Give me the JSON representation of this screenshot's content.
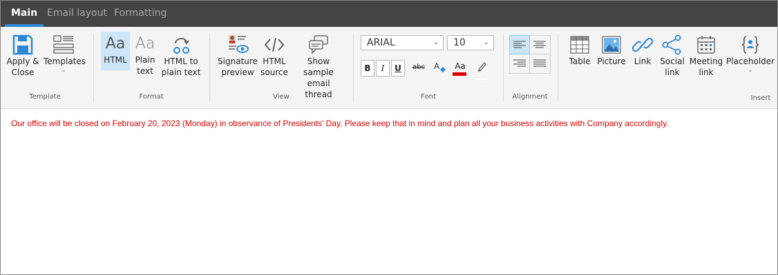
{
  "tabs": [
    {
      "label": "Main",
      "active": true
    },
    {
      "label": "Email layout",
      "active": false
    },
    {
      "label": "Formatting",
      "active": false
    }
  ],
  "groups": {
    "template": {
      "label": "Template",
      "apply_close": {
        "line1": "Apply &",
        "line2": "Close",
        "icon": "floppy-disk-icon"
      },
      "templates": {
        "line1": "Templates",
        "icon": "templates-list-icon"
      }
    },
    "format": {
      "label": "Format",
      "html": {
        "icon_text": "Aa",
        "line1": "HTML"
      },
      "plain": {
        "icon_text": "Aa",
        "line1": "Plain",
        "line2": "text"
      },
      "html_to_plain": {
        "line1": "HTML to",
        "line2": "plain text",
        "icon": "convert-icon"
      }
    },
    "view": {
      "label": "View",
      "signature_preview": {
        "line1": "Signature",
        "line2": "preview",
        "icon": "signature-preview-icon"
      },
      "html_source": {
        "line1": "HTML",
        "line2": "source",
        "icon": "code-icon"
      },
      "sample_thread": {
        "line1": "Show sample",
        "line2": "email thread",
        "icon": "chat-bubbles-icon"
      }
    },
    "font": {
      "label": "Font",
      "family": "ARIAL",
      "size": "10",
      "bold": "B",
      "italic": "I",
      "underline": "U",
      "strikethrough": "abc",
      "text_color": "Aa",
      "text_color_value": "#e00000",
      "highlight_color_value": "#ffffff"
    },
    "alignment": {
      "label": "Alignment",
      "selected": "left"
    },
    "insert": {
      "label": "Insert",
      "table": {
        "line1": "Table",
        "icon": "table-icon"
      },
      "picture": {
        "line1": "Picture",
        "icon": "picture-icon"
      },
      "link": {
        "line1": "Link",
        "icon": "link-icon"
      },
      "social_link": {
        "line1": "Social",
        "line2": "link",
        "icon": "share-icon"
      },
      "meeting_link": {
        "line1": "Meeting",
        "line2": "link",
        "icon": "calendar-icon"
      },
      "placeholder": {
        "line1": "Placeholder",
        "icon": "placeholder-icon"
      }
    }
  },
  "editor": {
    "content": "Our office will be closed on February 20, 2023 (Monday) in observance of Presidents' Day. Please keep that in mind and plan all your business activities with Company accordingly.",
    "text_color": "#d90000"
  },
  "colors": {
    "tabbar_bg": "#444444",
    "accent": "#2b88d8",
    "ribbon_bg": "#f4f4f4",
    "icon_blue": "#2b88d8"
  }
}
